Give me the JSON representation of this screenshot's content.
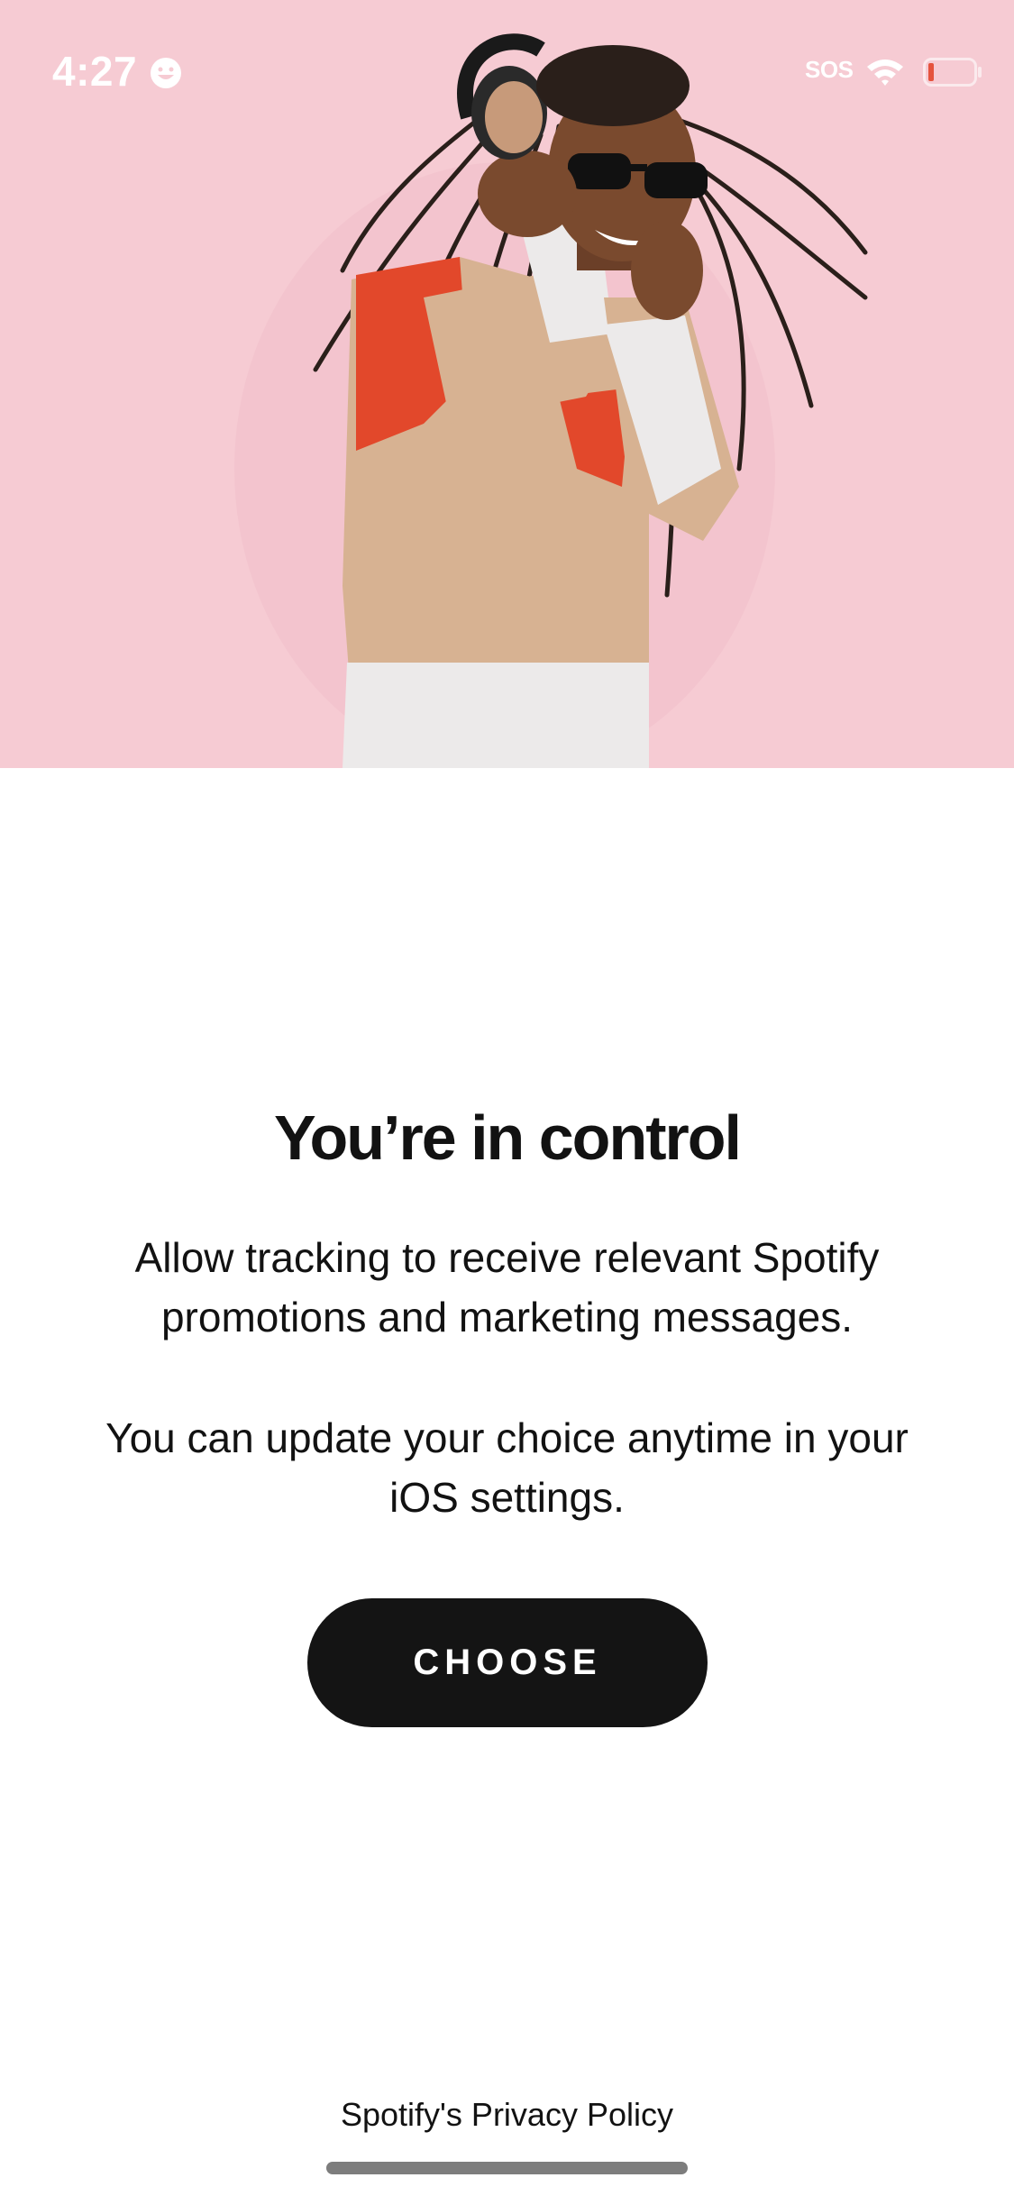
{
  "status_bar": {
    "time": "4:27",
    "carrier_text": "SOS",
    "emoji_icon": "smiley-face-icon",
    "wifi_icon": "wifi-icon",
    "battery_icon": "battery-low-icon",
    "battery_color": "#e5533d"
  },
  "hero": {
    "background_color": "#f6cbd3",
    "image_subject": "person-with-headphones-photo"
  },
  "content": {
    "headline": "You’re in control",
    "body_1": "Allow tracking to receive relevant Spotify promotions and marketing messages.",
    "body_2": "You can update your choice anytime in your iOS settings.",
    "choose_button": "CHOOSE",
    "privacy_link": "Spotify's Privacy Policy"
  },
  "colors": {
    "text": "#121212",
    "button_bg": "#141414",
    "button_text": "#ffffff",
    "page_bg": "#ffffff"
  }
}
